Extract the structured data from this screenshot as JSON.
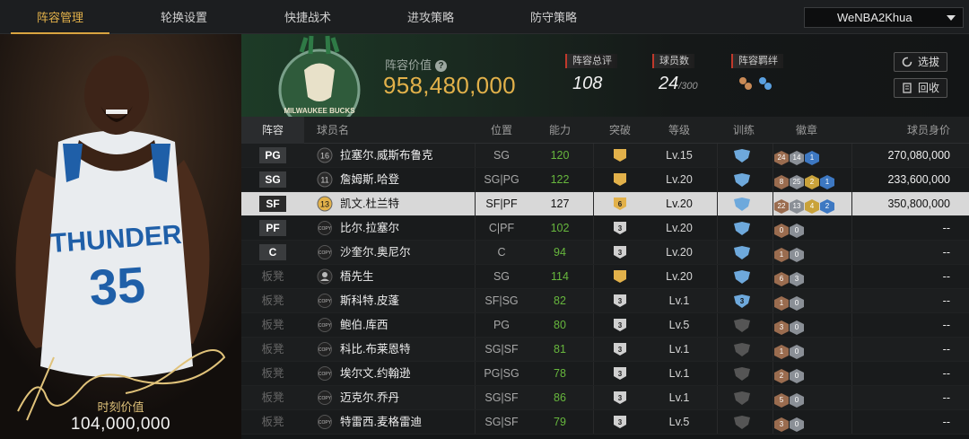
{
  "nav": {
    "tabs": [
      "阵容管理",
      "轮换设置",
      "快捷战术",
      "进攻策略",
      "防守策略"
    ],
    "active": 0,
    "user": "WeNBA2Khua"
  },
  "left_panel": {
    "moment_value_label": "时刻价值",
    "moment_value": "104,000,000",
    "jersey_text": "THUNDER",
    "jersey_number": "35"
  },
  "header": {
    "team_value_label": "阵容价值",
    "team_value": "958,480,000",
    "overall_label": "阵容总评",
    "overall_value": "108",
    "player_count_label": "球员数",
    "player_count": "24",
    "player_count_max": "/300",
    "chemistry_label": "阵容羁绊",
    "btn_select": "选拔",
    "btn_recycle": "回收",
    "logo_text": "MILWAUKEE BUCKS"
  },
  "table": {
    "headers": [
      "阵容",
      "球员名",
      "位置",
      "能力",
      "突破",
      "等级",
      "训练",
      "徽章",
      "球员身价"
    ],
    "rows": [
      {
        "slot": "PG",
        "starter": true,
        "num": "16",
        "name": "拉塞尔.威斯布鲁克",
        "pos": "SG",
        "power": "120",
        "brk": "gold",
        "brkn": "",
        "lv": "Lv.15",
        "trn": "blue",
        "trnn": "",
        "badges": [
          [
            "24",
            "bronze"
          ],
          [
            "14",
            "silver"
          ],
          [
            "1",
            "blue"
          ]
        ],
        "price": "270,080,000",
        "copy": false
      },
      {
        "slot": "SG",
        "starter": true,
        "num": "11",
        "name": "詹姆斯.哈登",
        "pos": "SG|PG",
        "power": "122",
        "brk": "gold",
        "brkn": "",
        "lv": "Lv.20",
        "trn": "blue",
        "trnn": "",
        "badges": [
          [
            "8",
            "bronze"
          ],
          [
            "25",
            "silver"
          ],
          [
            "2",
            "gold"
          ],
          [
            "1",
            "blue"
          ]
        ],
        "price": "233,600,000",
        "copy": false
      },
      {
        "slot": "SF",
        "starter": true,
        "num": "13",
        "name": "凯文.杜兰特",
        "pos": "SF|PF",
        "power": "127",
        "brk": "gold",
        "brkn": "6",
        "lv": "Lv.20",
        "trn": "blue",
        "trnn": "",
        "badges": [
          [
            "22",
            "bronze"
          ],
          [
            "13",
            "silver"
          ],
          [
            "4",
            "gold"
          ],
          [
            "2",
            "blue"
          ]
        ],
        "price": "350,800,000",
        "copy": false,
        "sel": true
      },
      {
        "slot": "PF",
        "starter": true,
        "num": "",
        "name": "比尔.拉塞尔",
        "pos": "C|PF",
        "power": "102",
        "brk": "grey",
        "brkn": "3",
        "lv": "Lv.20",
        "trn": "blue",
        "trnn": "",
        "badges": [
          [
            "0",
            "bronze"
          ],
          [
            "0",
            "silver"
          ]
        ],
        "price": "--",
        "copy": true
      },
      {
        "slot": "C",
        "starter": true,
        "num": "",
        "name": "沙奎尔.奥尼尔",
        "pos": "C",
        "power": "94",
        "brk": "grey",
        "brkn": "3",
        "lv": "Lv.20",
        "trn": "blue",
        "trnn": "",
        "badges": [
          [
            "1",
            "bronze"
          ],
          [
            "0",
            "silver"
          ]
        ],
        "price": "--",
        "copy": true
      },
      {
        "slot": "板凳",
        "starter": false,
        "num": "",
        "name": "梧先生",
        "pos": "SG",
        "power": "114",
        "brk": "gold",
        "brkn": "",
        "lv": "Lv.20",
        "trn": "blue",
        "trnn": "",
        "badges": [
          [
            "6",
            "bronze"
          ],
          [
            "3",
            "silver"
          ]
        ],
        "price": "--",
        "copy": false,
        "avatar": true
      },
      {
        "slot": "板凳",
        "starter": false,
        "num": "",
        "name": "斯科特.皮蓬",
        "pos": "SF|SG",
        "power": "82",
        "brk": "grey",
        "brkn": "3",
        "lv": "Lv.1",
        "trn": "blue",
        "trnn": "3",
        "badges": [
          [
            "1",
            "bronze"
          ],
          [
            "0",
            "silver"
          ]
        ],
        "price": "--",
        "copy": true
      },
      {
        "slot": "板凳",
        "starter": false,
        "num": "",
        "name": "鲍伯.库西",
        "pos": "PG",
        "power": "80",
        "brk": "grey",
        "brkn": "3",
        "lv": "Lv.5",
        "trn": "grey",
        "trnn": "",
        "badges": [
          [
            "3",
            "bronze"
          ],
          [
            "0",
            "silver"
          ]
        ],
        "price": "--",
        "copy": true
      },
      {
        "slot": "板凳",
        "starter": false,
        "num": "",
        "name": "科比.布莱恩特",
        "pos": "SG|SF",
        "power": "81",
        "brk": "grey",
        "brkn": "3",
        "lv": "Lv.1",
        "trn": "grey",
        "trnn": "",
        "badges": [
          [
            "1",
            "bronze"
          ],
          [
            "0",
            "silver"
          ]
        ],
        "price": "--",
        "copy": true
      },
      {
        "slot": "板凳",
        "starter": false,
        "num": "",
        "name": "埃尔文.约翰逊",
        "pos": "PG|SG",
        "power": "78",
        "brk": "grey",
        "brkn": "3",
        "lv": "Lv.1",
        "trn": "grey",
        "trnn": "",
        "badges": [
          [
            "2",
            "bronze"
          ],
          [
            "0",
            "silver"
          ]
        ],
        "price": "--",
        "copy": true
      },
      {
        "slot": "板凳",
        "starter": false,
        "num": "",
        "name": "迈克尔.乔丹",
        "pos": "SG|SF",
        "power": "86",
        "brk": "grey",
        "brkn": "3",
        "lv": "Lv.1",
        "trn": "grey",
        "trnn": "",
        "badges": [
          [
            "5",
            "bronze"
          ],
          [
            "0",
            "silver"
          ]
        ],
        "price": "--",
        "copy": true
      },
      {
        "slot": "板凳",
        "starter": false,
        "num": "",
        "name": "特雷西.麦格雷迪",
        "pos": "SG|SF",
        "power": "79",
        "brk": "grey",
        "brkn": "3",
        "lv": "Lv.5",
        "trn": "grey",
        "trnn": "",
        "badges": [
          [
            "3",
            "bronze"
          ],
          [
            "0",
            "silver"
          ]
        ],
        "price": "--",
        "copy": true
      }
    ]
  },
  "colors": {
    "accent_gold": "#e2b14a",
    "power_green": "#67b73d",
    "selected_row": "#d8d8d8"
  }
}
